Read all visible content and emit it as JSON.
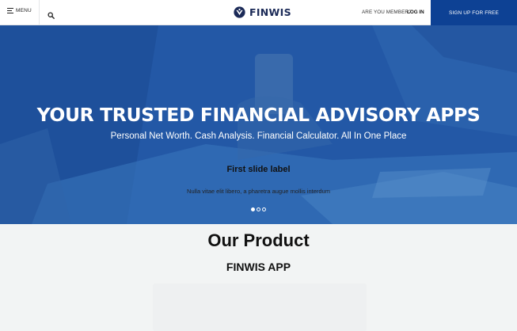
{
  "navbar": {
    "menu_label": "MENU",
    "brand": "FINWIS",
    "member_prompt": "ARE YOU MEMBER?",
    "login_label": "LOG IN",
    "signup_label": "SIGN UP FOR FREE"
  },
  "hero": {
    "title": "YOUR TRUSTED FINANCIAL ADVISORY APPS",
    "subtitle": "Personal Net Worth. Cash Analysis. Financial Calculator. All In One Place",
    "slide_label": "First slide label",
    "slide_text": "Nulla vitae elit libero, a pharetra augue mollis interdum",
    "slide_count": 3,
    "active_slide": 1
  },
  "products": {
    "section_title": "Our Product",
    "product_name": "FINWIS APP"
  },
  "colors": {
    "brand_navy": "#1b2a57",
    "signup_blue": "#0d4194",
    "hero_blue": "#2a62ad"
  }
}
